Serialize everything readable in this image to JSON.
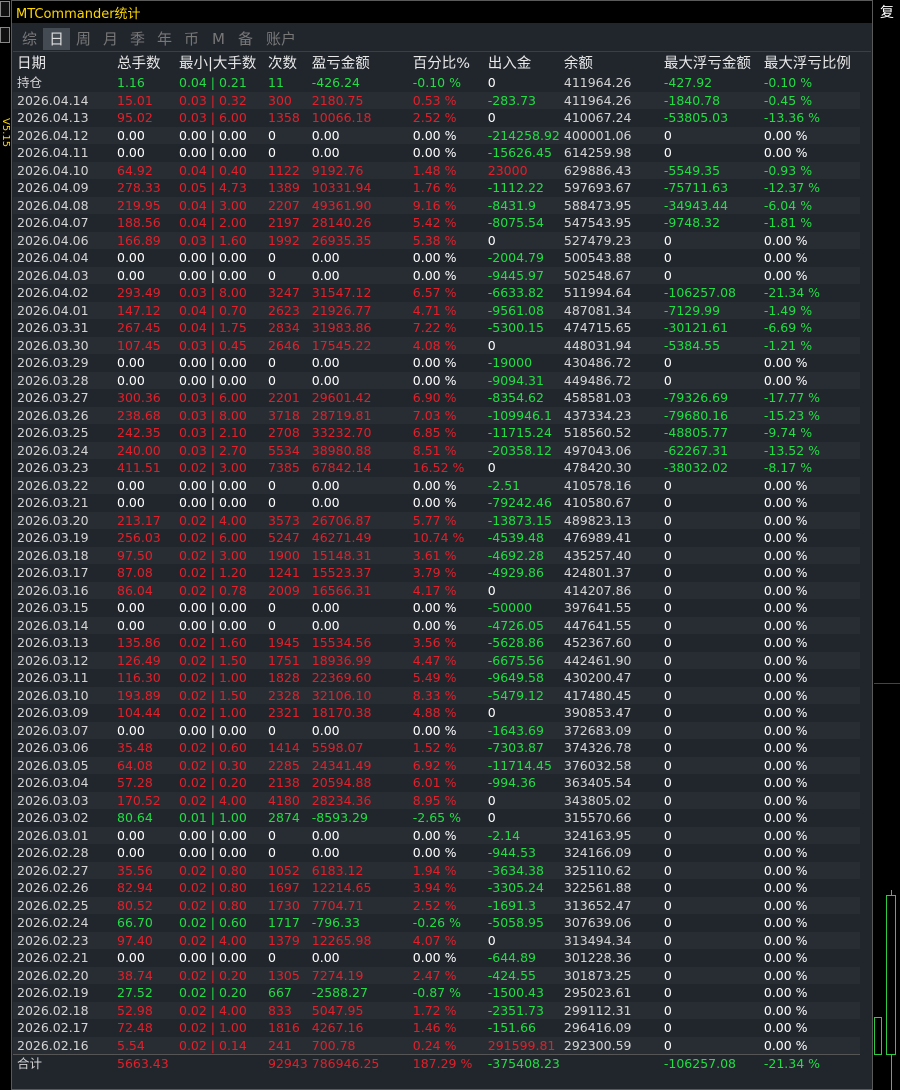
{
  "window": {
    "title": "MTCommander统计"
  },
  "tabs": [
    "综",
    "日",
    "周",
    "月",
    "季",
    "年",
    "币",
    "M",
    "备",
    "账户"
  ],
  "active_tab": 1,
  "side": {
    "left_version": "V5.15",
    "right_label": "复"
  },
  "columns": [
    "日期",
    "总手数",
    "最小|大手数",
    "次数",
    "盈亏金额",
    "百分比%",
    "出入金",
    "余额",
    "最大浮亏金额",
    "最大浮亏比例"
  ],
  "colors": {
    "profit": "#e0202a",
    "loss": "#22dd44",
    "background": "#21262d",
    "title": "#ffd700"
  },
  "rows": [
    [
      "持仓",
      "1.16",
      "0.04 | 0.21",
      "11",
      "-426.24",
      "-0.10 %",
      "0",
      "411964.26",
      "-427.92",
      "-0.10 %"
    ],
    [
      "2026.04.14",
      "15.01",
      "0.03 | 0.32",
      "300",
      "2180.75",
      "0.53 %",
      "-283.73",
      "411964.26",
      "-1840.78",
      "-0.45 %"
    ],
    [
      "2026.04.13",
      "95.02",
      "0.03 | 6.00",
      "1358",
      "10066.18",
      "2.52 %",
      "0",
      "410067.24",
      "-53805.03",
      "-13.36 %"
    ],
    [
      "2026.04.12",
      "0.00",
      "0.00 | 0.00",
      "0",
      "0.00",
      "0.00 %",
      "-214258.92",
      "400001.06",
      "0",
      "0.00 %"
    ],
    [
      "2026.04.11",
      "0.00",
      "0.00 | 0.00",
      "0",
      "0.00",
      "0.00 %",
      "-15626.45",
      "614259.98",
      "0",
      "0.00 %"
    ],
    [
      "2026.04.10",
      "64.92",
      "0.04 | 0.40",
      "1122",
      "9192.76",
      "1.48 %",
      "23000",
      "629886.43",
      "-5549.35",
      "-0.93 %"
    ],
    [
      "2026.04.09",
      "278.33",
      "0.05 | 4.73",
      "1389",
      "10331.94",
      "1.76 %",
      "-1112.22",
      "597693.67",
      "-75711.63",
      "-12.37 %"
    ],
    [
      "2026.04.08",
      "219.95",
      "0.04 | 3.00",
      "2207",
      "49361.90",
      "9.16 %",
      "-8431.9",
      "588473.95",
      "-34943.44",
      "-6.04 %"
    ],
    [
      "2026.04.07",
      "188.56",
      "0.04 | 2.00",
      "2197",
      "28140.26",
      "5.42 %",
      "-8075.54",
      "547543.95",
      "-9748.32",
      "-1.81 %"
    ],
    [
      "2026.04.06",
      "166.89",
      "0.03 | 1.60",
      "1992",
      "26935.35",
      "5.38 %",
      "0",
      "527479.23",
      "0",
      "0.00 %"
    ],
    [
      "2026.04.04",
      "0.00",
      "0.00 | 0.00",
      "0",
      "0.00",
      "0.00 %",
      "-2004.79",
      "500543.88",
      "0",
      "0.00 %"
    ],
    [
      "2026.04.03",
      "0.00",
      "0.00 | 0.00",
      "0",
      "0.00",
      "0.00 %",
      "-9445.97",
      "502548.67",
      "0",
      "0.00 %"
    ],
    [
      "2026.04.02",
      "293.49",
      "0.03 | 8.00",
      "3247",
      "31547.12",
      "6.57 %",
      "-6633.82",
      "511994.64",
      "-106257.08",
      "-21.34 %"
    ],
    [
      "2026.04.01",
      "147.12",
      "0.04 | 0.70",
      "2623",
      "21926.77",
      "4.71 %",
      "-9561.08",
      "487081.34",
      "-7129.99",
      "-1.49 %"
    ],
    [
      "2026.03.31",
      "267.45",
      "0.04 | 1.75",
      "2834",
      "31983.86",
      "7.22 %",
      "-5300.15",
      "474715.65",
      "-30121.61",
      "-6.69 %"
    ],
    [
      "2026.03.30",
      "107.45",
      "0.03 | 0.45",
      "2646",
      "17545.22",
      "4.08 %",
      "0",
      "448031.94",
      "-5384.55",
      "-1.21 %"
    ],
    [
      "2026.03.29",
      "0.00",
      "0.00 | 0.00",
      "0",
      "0.00",
      "0.00 %",
      "-19000",
      "430486.72",
      "0",
      "0.00 %"
    ],
    [
      "2026.03.28",
      "0.00",
      "0.00 | 0.00",
      "0",
      "0.00",
      "0.00 %",
      "-9094.31",
      "449486.72",
      "0",
      "0.00 %"
    ],
    [
      "2026.03.27",
      "300.36",
      "0.03 | 6.00",
      "2201",
      "29601.42",
      "6.90 %",
      "-8354.62",
      "458581.03",
      "-79326.69",
      "-17.77 %"
    ],
    [
      "2026.03.26",
      "238.68",
      "0.03 | 8.00",
      "3718",
      "28719.81",
      "7.03 %",
      "-109946.1",
      "437334.23",
      "-79680.16",
      "-15.23 %"
    ],
    [
      "2026.03.25",
      "242.35",
      "0.03 | 2.10",
      "2708",
      "33232.70",
      "6.85 %",
      "-11715.24",
      "518560.52",
      "-48805.77",
      "-9.74 %"
    ],
    [
      "2026.03.24",
      "240.00",
      "0.03 | 2.70",
      "5534",
      "38980.88",
      "8.51 %",
      "-20358.12",
      "497043.06",
      "-62267.31",
      "-13.52 %"
    ],
    [
      "2026.03.23",
      "411.51",
      "0.02 | 3.00",
      "7385",
      "67842.14",
      "16.52 %",
      "0",
      "478420.30",
      "-38032.02",
      "-8.17 %"
    ],
    [
      "2026.03.22",
      "0.00",
      "0.00 | 0.00",
      "0",
      "0.00",
      "0.00 %",
      "-2.51",
      "410578.16",
      "0",
      "0.00 %"
    ],
    [
      "2026.03.21",
      "0.00",
      "0.00 | 0.00",
      "0",
      "0.00",
      "0.00 %",
      "-79242.46",
      "410580.67",
      "0",
      "0.00 %"
    ],
    [
      "2026.03.20",
      "213.17",
      "0.02 | 4.00",
      "3573",
      "26706.87",
      "5.77 %",
      "-13873.15",
      "489823.13",
      "0",
      "0.00 %"
    ],
    [
      "2026.03.19",
      "256.03",
      "0.02 | 6.00",
      "5247",
      "46271.49",
      "10.74 %",
      "-4539.48",
      "476989.41",
      "0",
      "0.00 %"
    ],
    [
      "2026.03.18",
      "97.50",
      "0.02 | 3.00",
      "1900",
      "15148.31",
      "3.61 %",
      "-4692.28",
      "435257.40",
      "0",
      "0.00 %"
    ],
    [
      "2026.03.17",
      "87.08",
      "0.02 | 1.20",
      "1241",
      "15523.37",
      "3.79 %",
      "-4929.86",
      "424801.37",
      "0",
      "0.00 %"
    ],
    [
      "2026.03.16",
      "86.04",
      "0.02 | 0.78",
      "2009",
      "16566.31",
      "4.17 %",
      "0",
      "414207.86",
      "0",
      "0.00 %"
    ],
    [
      "2026.03.15",
      "0.00",
      "0.00 | 0.00",
      "0",
      "0.00",
      "0.00 %",
      "-50000",
      "397641.55",
      "0",
      "0.00 %"
    ],
    [
      "2026.03.14",
      "0.00",
      "0.00 | 0.00",
      "0",
      "0.00",
      "0.00 %",
      "-4726.05",
      "447641.55",
      "0",
      "0.00 %"
    ],
    [
      "2026.03.13",
      "135.86",
      "0.02 | 1.60",
      "1945",
      "15534.56",
      "3.56 %",
      "-5628.86",
      "452367.60",
      "0",
      "0.00 %"
    ],
    [
      "2026.03.12",
      "126.49",
      "0.02 | 1.50",
      "1751",
      "18936.99",
      "4.47 %",
      "-6675.56",
      "442461.90",
      "0",
      "0.00 %"
    ],
    [
      "2026.03.11",
      "116.30",
      "0.02 | 1.00",
      "1828",
      "22369.60",
      "5.49 %",
      "-9649.58",
      "430200.47",
      "0",
      "0.00 %"
    ],
    [
      "2026.03.10",
      "193.89",
      "0.02 | 1.50",
      "2328",
      "32106.10",
      "8.33 %",
      "-5479.12",
      "417480.45",
      "0",
      "0.00 %"
    ],
    [
      "2026.03.09",
      "104.44",
      "0.02 | 1.00",
      "2321",
      "18170.38",
      "4.88 %",
      "0",
      "390853.47",
      "0",
      "0.00 %"
    ],
    [
      "2026.03.07",
      "0.00",
      "0.00 | 0.00",
      "0",
      "0.00",
      "0.00 %",
      "-1643.69",
      "372683.09",
      "0",
      "0.00 %"
    ],
    [
      "2026.03.06",
      "35.48",
      "0.02 | 0.60",
      "1414",
      "5598.07",
      "1.52 %",
      "-7303.87",
      "374326.78",
      "0",
      "0.00 %"
    ],
    [
      "2026.03.05",
      "64.08",
      "0.02 | 0.30",
      "2285",
      "24341.49",
      "6.92 %",
      "-11714.45",
      "376032.58",
      "0",
      "0.00 %"
    ],
    [
      "2026.03.04",
      "57.28",
      "0.02 | 0.20",
      "2138",
      "20594.88",
      "6.01 %",
      "-994.36",
      "363405.54",
      "0",
      "0.00 %"
    ],
    [
      "2026.03.03",
      "170.52",
      "0.02 | 4.00",
      "4180",
      "28234.36",
      "8.95 %",
      "0",
      "343805.02",
      "0",
      "0.00 %"
    ],
    [
      "2026.03.02",
      "80.64",
      "0.01 | 1.00",
      "2874",
      "-8593.29",
      "-2.65 %",
      "0",
      "315570.66",
      "0",
      "0.00 %"
    ],
    [
      "2026.03.01",
      "0.00",
      "0.00 | 0.00",
      "0",
      "0.00",
      "0.00 %",
      "-2.14",
      "324163.95",
      "0",
      "0.00 %"
    ],
    [
      "2026.02.28",
      "0.00",
      "0.00 | 0.00",
      "0",
      "0.00",
      "0.00 %",
      "-944.53",
      "324166.09",
      "0",
      "0.00 %"
    ],
    [
      "2026.02.27",
      "35.56",
      "0.02 | 0.80",
      "1052",
      "6183.12",
      "1.94 %",
      "-3634.38",
      "325110.62",
      "0",
      "0.00 %"
    ],
    [
      "2026.02.26",
      "82.94",
      "0.02 | 0.80",
      "1697",
      "12214.65",
      "3.94 %",
      "-3305.24",
      "322561.88",
      "0",
      "0.00 %"
    ],
    [
      "2026.02.25",
      "80.52",
      "0.02 | 0.80",
      "1730",
      "7704.71",
      "2.52 %",
      "-1691.3",
      "313652.47",
      "0",
      "0.00 %"
    ],
    [
      "2026.02.24",
      "66.70",
      "0.02 | 0.60",
      "1717",
      "-796.33",
      "-0.26 %",
      "-5058.95",
      "307639.06",
      "0",
      "0.00 %"
    ],
    [
      "2026.02.23",
      "97.40",
      "0.02 | 4.00",
      "1379",
      "12265.98",
      "4.07 %",
      "0",
      "313494.34",
      "0",
      "0.00 %"
    ],
    [
      "2026.02.21",
      "0.00",
      "0.00 | 0.00",
      "0",
      "0.00",
      "0.00 %",
      "-644.89",
      "301228.36",
      "0",
      "0.00 %"
    ],
    [
      "2026.02.20",
      "38.74",
      "0.02 | 0.20",
      "1305",
      "7274.19",
      "2.47 %",
      "-424.55",
      "301873.25",
      "0",
      "0.00 %"
    ],
    [
      "2026.02.19",
      "27.52",
      "0.02 | 0.20",
      "667",
      "-2588.27",
      "-0.87 %",
      "-1500.43",
      "295023.61",
      "0",
      "0.00 %"
    ],
    [
      "2026.02.18",
      "52.98",
      "0.02 | 4.00",
      "833",
      "5047.95",
      "1.72 %",
      "-2351.73",
      "299112.31",
      "0",
      "0.00 %"
    ],
    [
      "2026.02.17",
      "72.48",
      "0.02 | 1.00",
      "1816",
      "4267.16",
      "1.46 %",
      "-151.66",
      "296416.09",
      "0",
      "0.00 %"
    ],
    [
      "2026.02.16",
      "5.54",
      "0.02 | 0.14",
      "241",
      "700.78",
      "0.24 %",
      "291599.81",
      "292300.59",
      "0",
      "0.00 %"
    ]
  ],
  "total": [
    "合计",
    "5663.43",
    "",
    "92943",
    "786946.25",
    "187.29 %",
    "-375408.23",
    "",
    "-106257.08",
    "-21.34 %"
  ]
}
